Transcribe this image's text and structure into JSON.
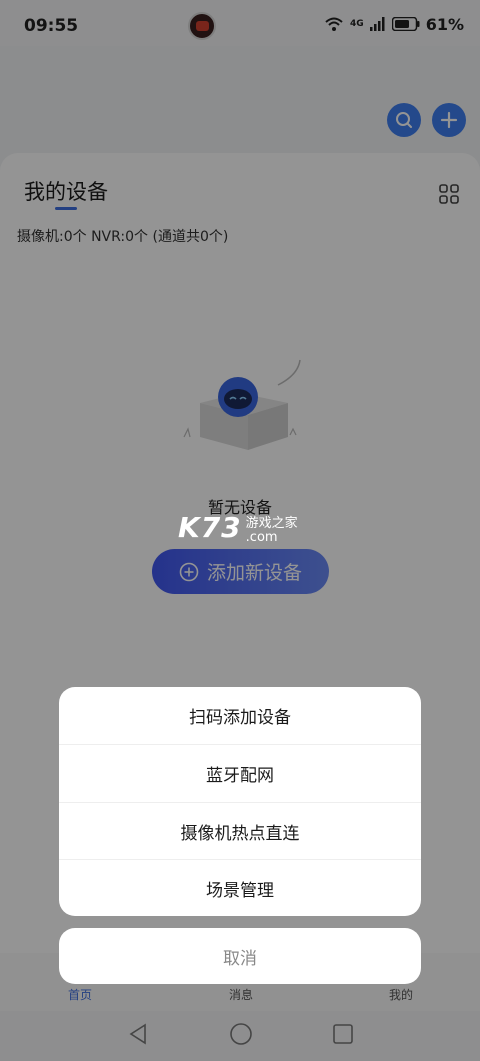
{
  "status": {
    "time": "09:55",
    "signal": "4G",
    "battery": "61%"
  },
  "header": {
    "search_icon": "search-icon",
    "add_icon": "plus-icon"
  },
  "device_card": {
    "title": "我的设备",
    "summary": "摄像机:0个 NVR:0个 (通道共0个)",
    "empty_text": "暂无设备",
    "add_button_label": "添加新设备"
  },
  "watermark": {
    "logo": "K73",
    "line1": "游戏之家",
    "line2": ".com"
  },
  "action_sheet": {
    "items": [
      "扫码添加设备",
      "蓝牙配网",
      "摄像机热点直连",
      "场景管理"
    ],
    "cancel": "取消"
  },
  "tabbar": {
    "tabs": [
      "首页",
      "消息",
      "我的"
    ]
  },
  "colors": {
    "accent": "#3f7ff0",
    "active_tab": "#3f6fe0"
  }
}
